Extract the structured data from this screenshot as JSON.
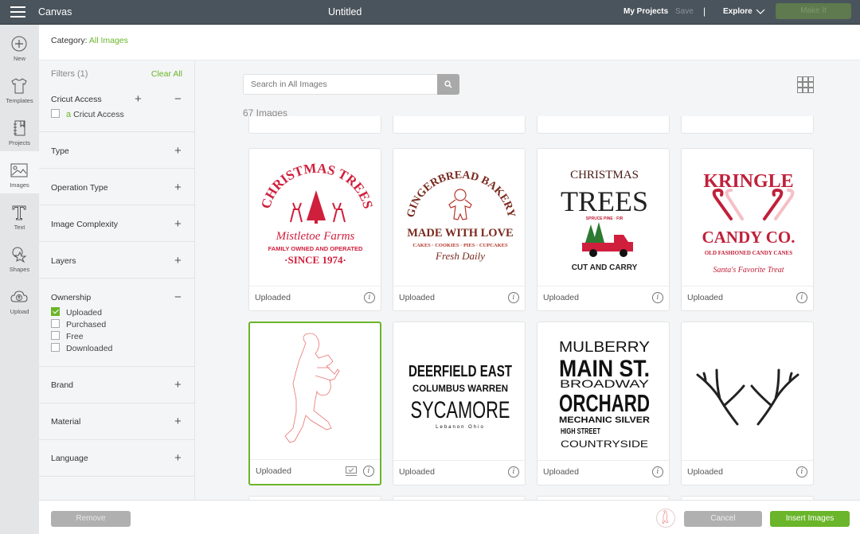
{
  "topbar": {
    "menu_icon": "hamburger-menu-icon",
    "app_title": "Canvas",
    "document_title": "Untitled",
    "my_projects": "My Projects",
    "save": "Save",
    "separator": "|",
    "explore": "Explore",
    "make_it": "Make It"
  },
  "rail": {
    "items": [
      {
        "label": "New",
        "icon": "plus-circle-icon"
      },
      {
        "label": "Templates",
        "icon": "tshirt-icon"
      },
      {
        "label": "Projects",
        "icon": "notebook-icon"
      },
      {
        "label": "Images",
        "icon": "image-icon",
        "active": true
      },
      {
        "label": "Text",
        "icon": "text-t-icon"
      },
      {
        "label": "Shapes",
        "icon": "shapes-icon"
      },
      {
        "label": "Upload",
        "icon": "cloud-upload-icon"
      }
    ]
  },
  "category": {
    "label": "Category:",
    "value": "All Images"
  },
  "filters": {
    "title": "Filters (1)",
    "clear_all": "Clear All",
    "sections": [
      {
        "name": "Cricut Access",
        "options": [
          {
            "label": "Cricut Access",
            "checked": false
          }
        ]
      },
      {
        "name": "Type"
      },
      {
        "name": "Operation Type"
      },
      {
        "name": "Image Complexity"
      },
      {
        "name": "Layers"
      },
      {
        "name": "Ownership",
        "options": [
          {
            "label": "Uploaded",
            "checked": true
          },
          {
            "label": "Purchased",
            "checked": false
          },
          {
            "label": "Free",
            "checked": false
          },
          {
            "label": "Downloaded",
            "checked": false
          }
        ]
      },
      {
        "name": "Brand"
      },
      {
        "name": "Material"
      },
      {
        "name": "Language"
      }
    ]
  },
  "search": {
    "placeholder": "Search in All Images",
    "value": ""
  },
  "results": {
    "count": "67 Images"
  },
  "images": [
    {
      "label": "Uploaded",
      "title": "CHRISTMAS TREES",
      "line2": "Mistletoe Farms",
      "line3": "FAMILY OWNED AND OPERATED",
      "line4": "·SINCE 1974·",
      "selected": false
    },
    {
      "label": "Uploaded",
      "title": "GINGERBREAD BAKERY",
      "line2": "MADE WITH LOVE",
      "line3": "CAKES · COOKIES · PIES · CUPCAKES",
      "line4": "Fresh Daily",
      "selected": false
    },
    {
      "label": "Uploaded",
      "title": "CHRISTMAS",
      "line2": "TREES",
      "line3": "SPRUCE   PINE · FIR",
      "line4": "CUT AND CARRY",
      "selected": false
    },
    {
      "label": "Uploaded",
      "title": "KRINGLE",
      "line2": "CANDY CO.",
      "line3": "OLD FASHIONED CANDY CANES",
      "line4": "Santa's Favorite Treat",
      "selected": false
    },
    {
      "label": "Uploaded",
      "title": "drummer-boy-outline",
      "selected": true
    },
    {
      "label": "Uploaded",
      "title": "DEERFIELD EAST",
      "line2": "COLUMBUS WARREN",
      "line3": "SYCAMORE",
      "line4": "Lebanon Ohio",
      "selected": false
    },
    {
      "label": "Uploaded",
      "title": "MULBERRY",
      "line2": "MAIN ST.",
      "line3": "BROADWAY",
      "line4": "ORCHARD",
      "line5": "MECHANIC SILVER",
      "line6": "HIGH STREET",
      "line7": "COUNTRYSIDE",
      "selected": false
    },
    {
      "label": "Uploaded",
      "title": "antlers",
      "selected": false
    }
  ],
  "footer": {
    "remove": "Remove",
    "cancel": "Cancel",
    "insert": "Insert Images"
  },
  "colors": {
    "accent": "#6ab52a",
    "topbar": "#4a545c",
    "christmas_red": "#d01f3c",
    "bakery_brown": "#7a2a1e"
  }
}
